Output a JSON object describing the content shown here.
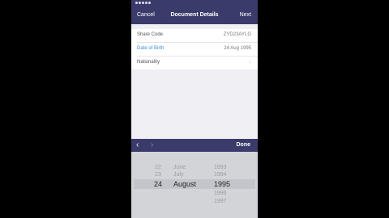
{
  "navbar": {
    "cancel_label": "Cancel",
    "title": "Document Details",
    "next_label": "Next"
  },
  "form": {
    "rows": [
      {
        "label": "Share Code",
        "value": "ZYD23AYLG"
      },
      {
        "label": "Date of Birth",
        "value": "24 Aug 1995"
      },
      {
        "label": "Nationality",
        "value": ""
      }
    ]
  },
  "toolbar": {
    "prev_icon": "chevron-left-icon",
    "next_icon": "chevron-right-icon",
    "done_label": "Done"
  },
  "picker": {
    "days": [
      "22",
      "23",
      "24"
    ],
    "months": [
      "June",
      "July",
      "August"
    ],
    "years": [
      "1993",
      "1994",
      "1995",
      "1996",
      "1997"
    ],
    "selected": {
      "day": "24",
      "month": "August",
      "year": "1995"
    }
  },
  "colors": {
    "navbar": "#3b3b6b",
    "accent": "#3d8ee0",
    "picker_bg": "#d2d4d8"
  }
}
